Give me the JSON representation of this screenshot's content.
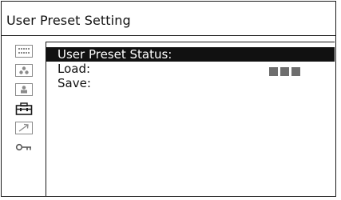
{
  "menu": {
    "title": "User Preset Setting"
  },
  "side_icons": [
    {
      "name": "grid-dots-icon"
    },
    {
      "name": "circles-icon"
    },
    {
      "name": "person-icon"
    },
    {
      "name": "toolbox-icon"
    },
    {
      "name": "arrow-up-right-icon"
    },
    {
      "name": "key-icon"
    }
  ],
  "items": {
    "status": {
      "label": "User Preset Status:"
    },
    "load": {
      "label": "Load:",
      "value_blocks": 3
    },
    "save": {
      "label": "Save:"
    }
  },
  "colors": {
    "selected_bg": "#111111",
    "selected_text": "#ffffff",
    "status_block": "#6e6e6e",
    "inactive_icon": "#8a8a8a",
    "active_icon": "#1a1a1a"
  }
}
